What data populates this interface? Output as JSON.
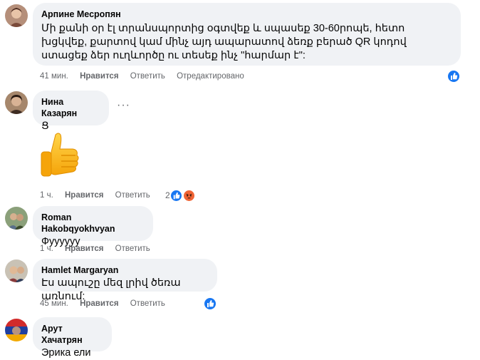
{
  "comments": [
    {
      "author": "Арпине Месропян",
      "text": "Մի քանի օր էլ տրանսպորտից օգտվեք և սպասեք 30-60րոպե, հետո խցկվեք, քարտով կամ մինչ այդ ապարատով ձեռք բերած QR կոդով ստացեք ձեր ուղևործը ու տեսեք ինչ \"հարմար է\":",
      "time": "41 мин.",
      "like_label": "Нравится",
      "reply_label": "Ответить",
      "edited_label": "Отредактировано"
    },
    {
      "author": "Нина Казарян",
      "text": "Ց",
      "time": "1 ч.",
      "like_label": "Нравится",
      "reply_label": "Ответить",
      "reaction_count": "2"
    },
    {
      "author": "Roman Hakobqyokhvyan",
      "text": "Фуууууу",
      "time": "1 ч.",
      "like_label": "Нравится",
      "reply_label": "Ответить"
    },
    {
      "author": "Hamlet Margaryan",
      "text": "Էս ապուշը մեզ լրիվ ծեռա առնում:",
      "time": "45 мин.",
      "like_label": "Нравится",
      "reply_label": "Ответить"
    },
    {
      "author": "Арут Хачатрян",
      "text": "Эрика ели"
    }
  ],
  "icons": {
    "like": "like-icon",
    "angry": "angry-icon",
    "more": "more-options-icon",
    "sticker": "thumbs-up-sticker"
  },
  "colors": {
    "like_blue": "#1877f2",
    "angry_orange": "#f06435",
    "bubble_bg": "#f0f2f5",
    "meta_gray": "#65676b"
  }
}
